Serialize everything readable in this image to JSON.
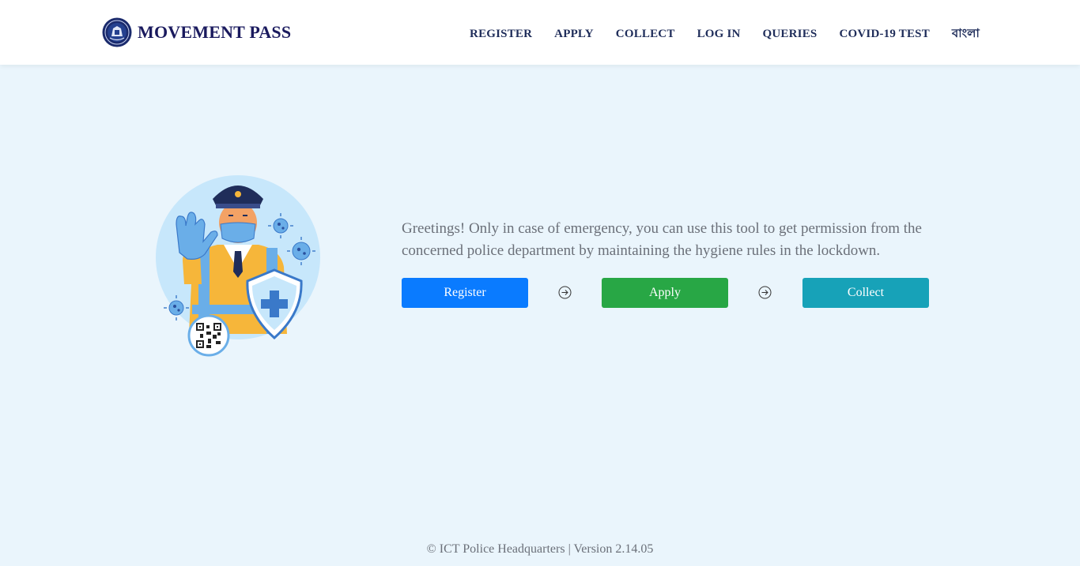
{
  "header": {
    "brand_name": "MOVEMENT PASS",
    "brand_icon": "police-emblem-icon",
    "nav": [
      {
        "label": "REGISTER"
      },
      {
        "label": "APPLY"
      },
      {
        "label": "COLLECT"
      },
      {
        "label": "LOG IN"
      },
      {
        "label": "QUERIES"
      },
      {
        "label": "COVID-19 TEST"
      },
      {
        "label": "বাংলা"
      }
    ]
  },
  "hero": {
    "illustration": "police-officer-stop-gesture-with-shield-and-qr-illustration",
    "intro_text": "Greetings! Only in case of emergency, you can use this tool to get permission from the concerned police department by maintaining the hygiene rules in the lockdown.",
    "steps": [
      {
        "label": "Register",
        "color": "#0a7bff"
      },
      {
        "label": "Apply",
        "color": "#28a745"
      },
      {
        "label": "Collect",
        "color": "#17a2b8"
      }
    ],
    "step_separator_icon": "arrow-right-circle-icon"
  },
  "footer": {
    "text": "© ICT Police Headquarters | Version 2.14.05"
  },
  "colors": {
    "background": "#eaf5fc",
    "navbar": "#ffffff",
    "brand_text": "#1a1a5e"
  }
}
